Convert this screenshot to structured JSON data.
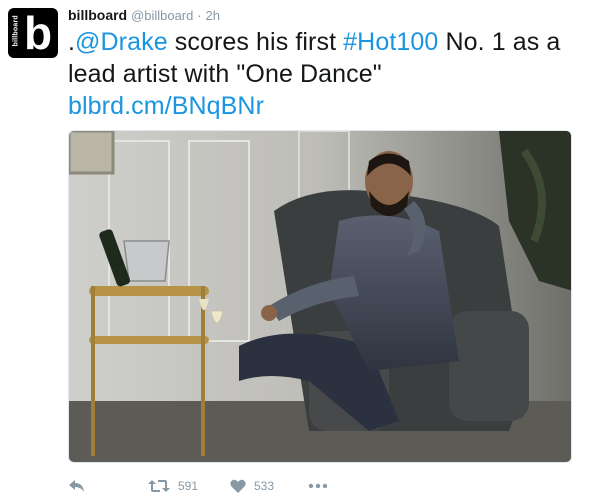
{
  "account": {
    "display_name": "billboard",
    "handle": "@billboard",
    "separator": "·",
    "time": "2h",
    "avatar_letter": "b",
    "avatar_word": "billboard"
  },
  "tweet": {
    "segments": [
      {
        "text": ".",
        "kind": "text"
      },
      {
        "text": "@Drake",
        "kind": "link"
      },
      {
        "text": " scores his first ",
        "kind": "text"
      },
      {
        "text": "#Hot100",
        "kind": "link"
      },
      {
        "text": " No. 1 as a lead artist with \"One Dance\" ",
        "kind": "text"
      },
      {
        "text": "blbrd.cm/BNqBNr",
        "kind": "link"
      }
    ]
  },
  "actions": {
    "retweet_count": "591",
    "like_count": "533"
  },
  "colors": {
    "link": "#1b95e0",
    "meta": "#8899a6",
    "text": "#14171a"
  }
}
